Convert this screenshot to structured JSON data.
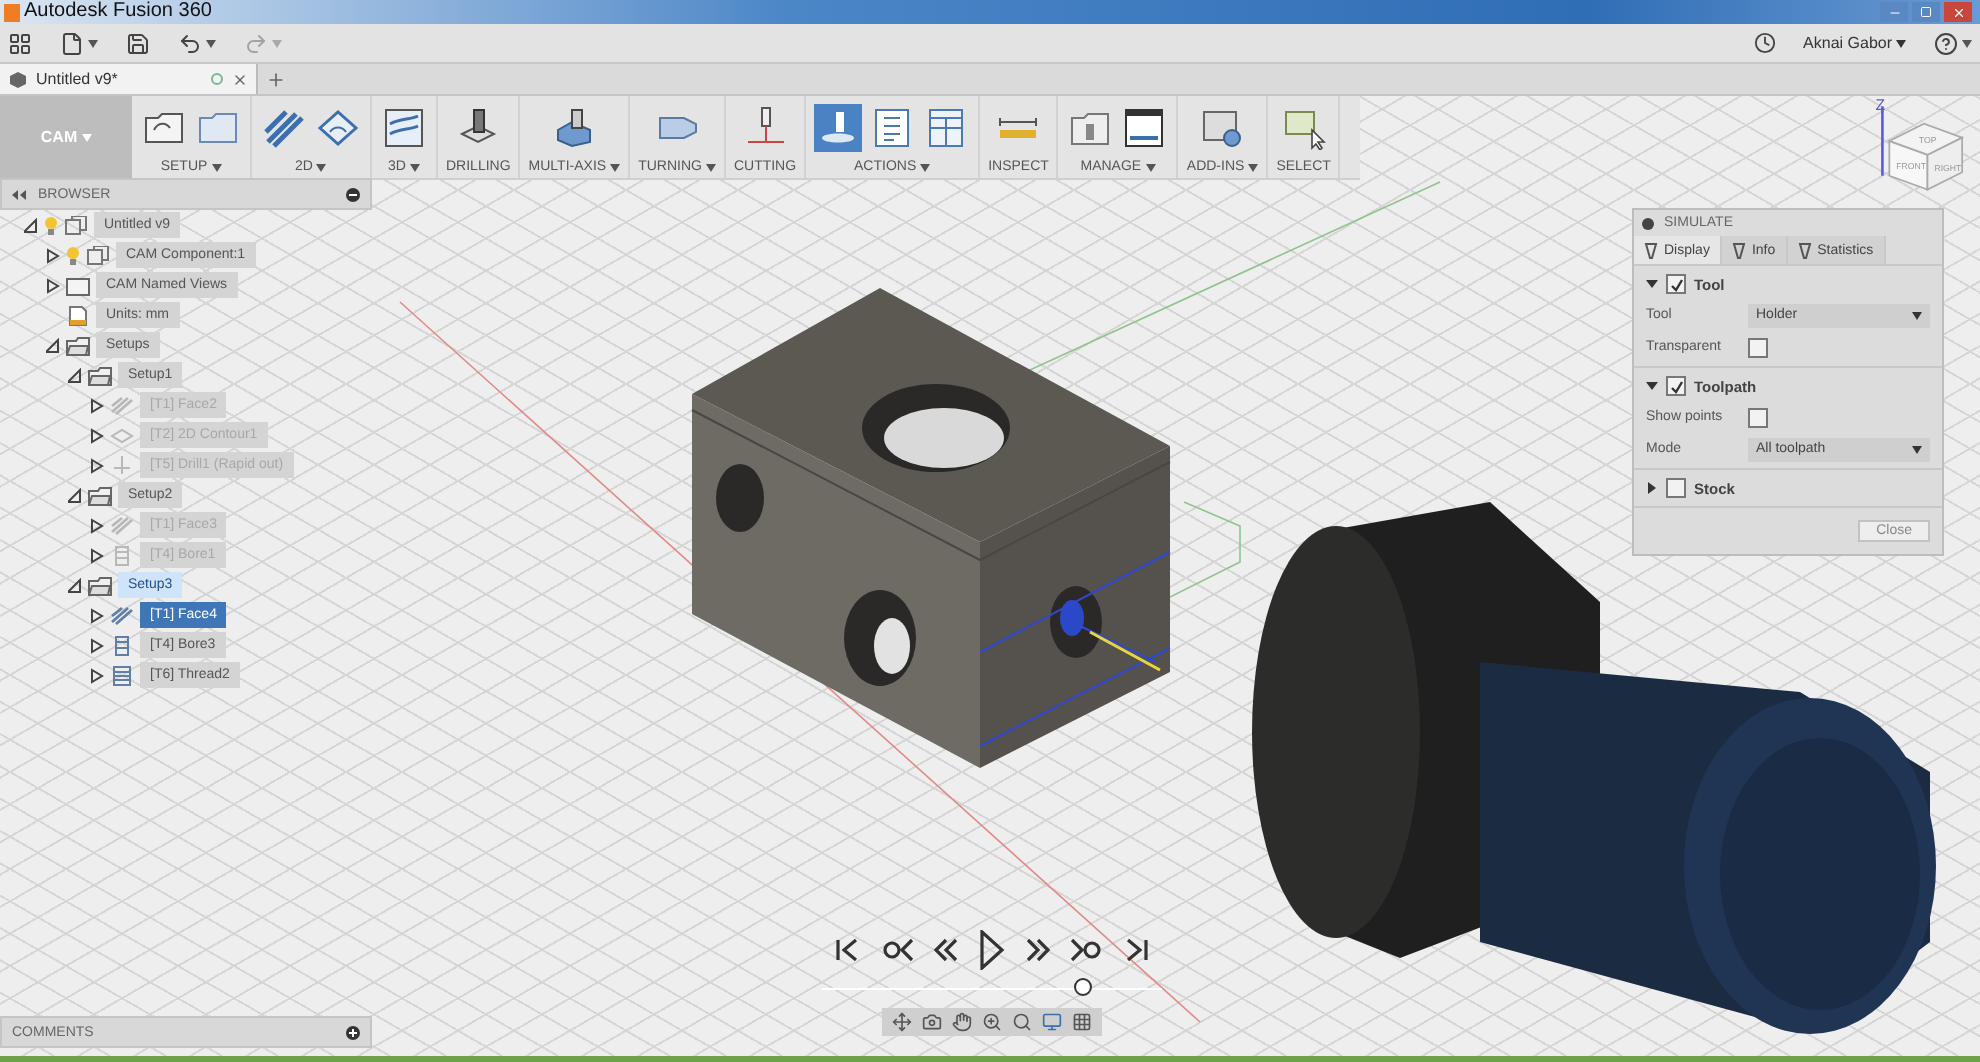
{
  "window": {
    "title": "Autodesk Fusion 360"
  },
  "quick_toolbar": {
    "user": "Aknai Gabor"
  },
  "document_tab": {
    "title": "Untitled v9*"
  },
  "ribbon": {
    "workspace": "CAM",
    "groups": [
      {
        "label": "SETUP",
        "dropdown": true,
        "tools": [
          {
            "kind": "new-setup",
            "selected": false
          },
          {
            "kind": "setup-folder",
            "selected": false
          }
        ]
      },
      {
        "label": "2D",
        "dropdown": true,
        "tools": [
          {
            "kind": "pocket",
            "selected": false
          },
          {
            "kind": "contour",
            "selected": false
          }
        ]
      },
      {
        "label": "3D",
        "dropdown": true,
        "tools": [
          {
            "kind": "adaptive",
            "selected": false
          }
        ]
      },
      {
        "label": "DRILLING",
        "dropdown": false,
        "tools": [
          {
            "kind": "drill",
            "selected": false
          }
        ]
      },
      {
        "label": "MULTI-AXIS",
        "dropdown": true,
        "tools": [
          {
            "kind": "multi-axis",
            "selected": false
          }
        ]
      },
      {
        "label": "TURNING",
        "dropdown": true,
        "tools": [
          {
            "kind": "turning",
            "selected": false
          }
        ]
      },
      {
        "label": "CUTTING",
        "dropdown": false,
        "tools": [
          {
            "kind": "cutting",
            "selected": false
          }
        ]
      },
      {
        "label": "ACTIONS",
        "dropdown": true,
        "tools": [
          {
            "kind": "simulate",
            "selected": true
          },
          {
            "kind": "gcode",
            "selected": false
          },
          {
            "kind": "sheet",
            "selected": false
          }
        ]
      },
      {
        "label": "INSPECT",
        "dropdown": false,
        "tools": [
          {
            "kind": "measure",
            "selected": false
          }
        ]
      },
      {
        "label": "MANAGE",
        "dropdown": true,
        "tools": [
          {
            "kind": "tool-library",
            "selected": false
          },
          {
            "kind": "post-library",
            "selected": false
          }
        ]
      },
      {
        "label": "ADD-INS",
        "dropdown": true,
        "tools": [
          {
            "kind": "script",
            "selected": false
          }
        ]
      },
      {
        "label": "SELECT",
        "dropdown": false,
        "tools": [
          {
            "kind": "select",
            "selected": false
          }
        ]
      }
    ]
  },
  "browser": {
    "title": "BROWSER",
    "tree": [
      {
        "label": "Untitled v9",
        "kind": "component",
        "visible": true,
        "expanded": true,
        "disabled": false,
        "selected": false,
        "active": false,
        "children": [
          {
            "label": "CAM Component:1",
            "kind": "component",
            "visible": true,
            "expanded": false,
            "disabled": false,
            "selected": false,
            "active": false
          },
          {
            "label": "CAM Named Views",
            "kind": "folder",
            "expanded": false,
            "disabled": false,
            "selected": false,
            "active": false
          },
          {
            "label": "Units: mm",
            "kind": "units",
            "disabled": false,
            "selected": false,
            "active": false
          },
          {
            "label": "Setups",
            "kind": "setup",
            "expanded": true,
            "disabled": false,
            "selected": false,
            "active": false,
            "children": [
              {
                "label": "Setup1",
                "kind": "setup",
                "expanded": true,
                "disabled": false,
                "selected": false,
                "active": false,
                "children": [
                  {
                    "label": "[T1] Face2",
                    "kind": "face",
                    "expanded": false,
                    "disabled": true,
                    "selected": false,
                    "active": false
                  },
                  {
                    "label": "[T2] 2D Contour1",
                    "kind": "contour",
                    "expanded": false,
                    "disabled": true,
                    "selected": false,
                    "active": false
                  },
                  {
                    "label": "[T5] Drill1 (Rapid out)",
                    "kind": "drill",
                    "expanded": false,
                    "disabled": true,
                    "selected": false,
                    "active": false
                  }
                ]
              },
              {
                "label": "Setup2",
                "kind": "setup",
                "expanded": true,
                "disabled": false,
                "selected": false,
                "active": false,
                "children": [
                  {
                    "label": "[T1] Face3",
                    "kind": "face",
                    "expanded": false,
                    "disabled": true,
                    "selected": false,
                    "active": false
                  },
                  {
                    "label": "[T4] Bore1",
                    "kind": "bore",
                    "expanded": false,
                    "disabled": true,
                    "selected": false,
                    "active": false
                  }
                ]
              },
              {
                "label": "Setup3",
                "kind": "setup",
                "expanded": true,
                "disabled": false,
                "selected": false,
                "active": true,
                "children": [
                  {
                    "label": "[T1] Face4",
                    "kind": "face",
                    "expanded": false,
                    "disabled": false,
                    "selected": true,
                    "active": false
                  },
                  {
                    "label": "[T4] Bore3",
                    "kind": "bore",
                    "expanded": false,
                    "disabled": false,
                    "selected": false,
                    "active": false
                  },
                  {
                    "label": "[T6] Thread2",
                    "kind": "thread",
                    "expanded": false,
                    "disabled": false,
                    "selected": false,
                    "active": false
                  }
                ]
              }
            ]
          }
        ]
      }
    ]
  },
  "simulate": {
    "title": "SIMULATE",
    "tabs": [
      {
        "label": "Display",
        "selected": true
      },
      {
        "label": "Info",
        "selected": false
      },
      {
        "label": "Statistics",
        "selected": false
      }
    ],
    "sections": [
      {
        "label": "Tool",
        "expanded": true,
        "checked": true,
        "rows": [
          {
            "kind": "select",
            "label": "Tool",
            "value": "Holder"
          },
          {
            "kind": "checkbox",
            "label": "Transparent",
            "checked": false
          }
        ]
      },
      {
        "label": "Toolpath",
        "expanded": true,
        "checked": true,
        "rows": [
          {
            "kind": "checkbox",
            "label": "Show points",
            "checked": false
          },
          {
            "kind": "select",
            "label": "Mode",
            "value": "All toolpath"
          }
        ]
      },
      {
        "label": "Stock",
        "expanded": false,
        "checked": false
      }
    ],
    "button": "Close"
  },
  "view_cube": {
    "axis": "Z",
    "faces": [
      "TOP",
      "FRONT",
      "RIGHT"
    ]
  },
  "playback": {
    "level": 0.77
  },
  "comments": {
    "title": "COMMENTS"
  }
}
